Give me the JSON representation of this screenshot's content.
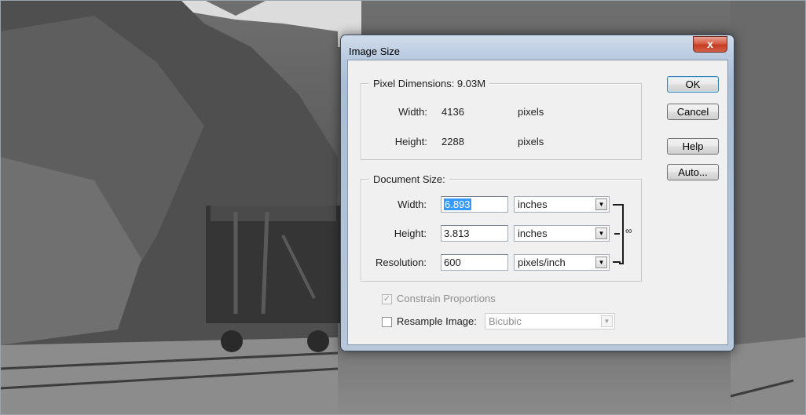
{
  "dialog": {
    "title": "Image Size",
    "close_glyph": "x"
  },
  "pixel_dimensions": {
    "legend": "Pixel Dimensions:  9.03M",
    "width_label": "Width:",
    "width_value": "4136",
    "width_unit": "pixels",
    "height_label": "Height:",
    "height_value": "2288",
    "height_unit": "pixels"
  },
  "document_size": {
    "legend": "Document Size:",
    "width_label": "Width:",
    "width_value": "6.893",
    "width_unit": "inches",
    "height_label": "Height:",
    "height_value": "3.813",
    "height_unit": "inches",
    "resolution_label": "Resolution:",
    "resolution_value": "600",
    "resolution_unit": "pixels/inch",
    "link_icon": "chain-link-icon"
  },
  "options": {
    "constrain_label": "Constrain Proportions",
    "constrain_checked": true,
    "constrain_enabled": false,
    "resample_label": "Resample Image:",
    "resample_checked": false,
    "resample_method": "Bicubic"
  },
  "buttons": {
    "ok": "OK",
    "cancel": "Cancel",
    "help": "Help",
    "auto": "Auto..."
  },
  "colors": {
    "selection": "#3399ff",
    "close_button": "#c53b21",
    "window_frame": "#b9cadf"
  }
}
